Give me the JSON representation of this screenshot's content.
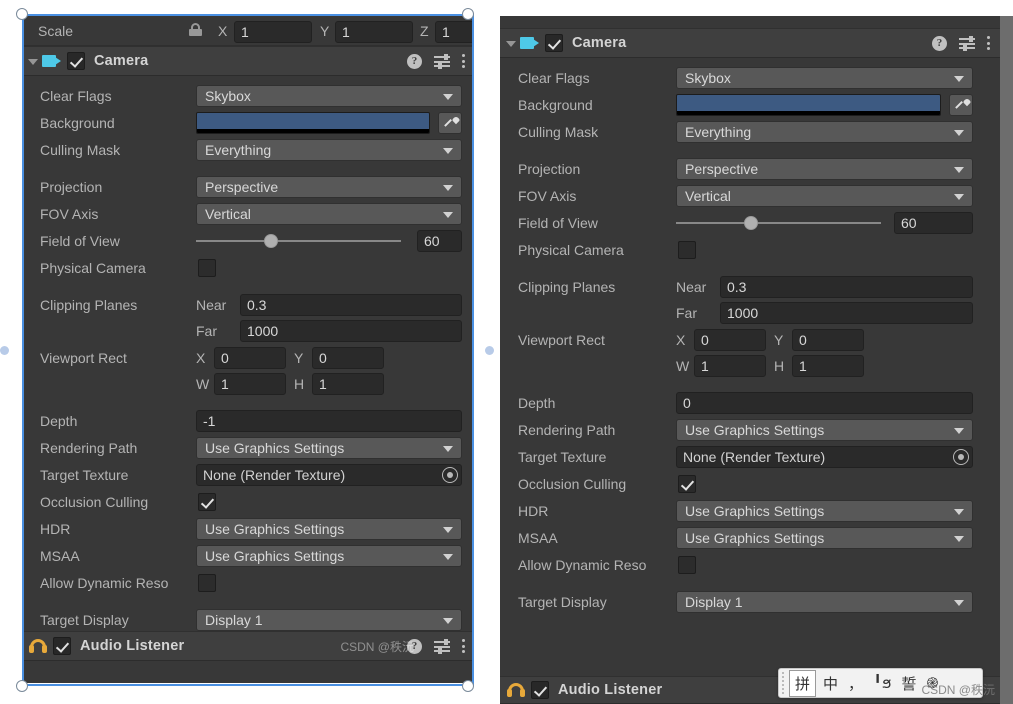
{
  "app": {
    "name": "Unity Inspector — Camera component comparison"
  },
  "scale_strip": {
    "label": "Scale",
    "lock_icon": "link-lock-icon",
    "axes": [
      {
        "axis": "X",
        "value": "1"
      },
      {
        "axis": "Y",
        "value": "1"
      },
      {
        "axis": "Z",
        "value": "1"
      }
    ]
  },
  "header_icons": {
    "help": "?",
    "help_name": "help-icon",
    "preset_name": "preset-settings-icon",
    "menu_name": "more-options-icon"
  },
  "left_panel": {
    "component": {
      "title": "Camera",
      "enabled": true,
      "icon": "camera-icon"
    },
    "fields": {
      "clear_flags_label": "Clear Flags",
      "clear_flags_value": "Skybox",
      "background_label": "Background",
      "background_color": "#3d5a82",
      "culling_mask_label": "Culling Mask",
      "culling_mask_value": "Everything",
      "projection_label": "Projection",
      "projection_value": "Perspective",
      "fov_axis_label": "FOV Axis",
      "fov_axis_value": "Vertical",
      "field_of_view_label": "Field of View",
      "field_of_view_value": "60",
      "field_of_view_percent": 33,
      "physical_camera_label": "Physical Camera",
      "physical_camera_checked": false,
      "clipping_planes_label": "Clipping Planes",
      "near_label": "Near",
      "near_value": "0.3",
      "far_label": "Far",
      "far_value": "1000",
      "viewport_rect_label": "Viewport Rect",
      "viewport_x_label": "X",
      "viewport_x_value": "0",
      "viewport_y_label": "Y",
      "viewport_y_value": "0",
      "viewport_w_label": "W",
      "viewport_w_value": "1",
      "viewport_h_label": "H",
      "viewport_h_value": "1",
      "depth_label": "Depth",
      "depth_value": "-1",
      "rendering_path_label": "Rendering Path",
      "rendering_path_value": "Use Graphics Settings",
      "target_texture_label": "Target Texture",
      "target_texture_value": "None (Render Texture)",
      "occlusion_culling_label": "Occlusion Culling",
      "occlusion_culling_checked": true,
      "hdr_label": "HDR",
      "hdr_value": "Use Graphics Settings",
      "msaa_label": "MSAA",
      "msaa_value": "Use Graphics Settings",
      "allow_dynamic_label": "Allow Dynamic Reso",
      "allow_dynamic_checked": false,
      "target_display_label": "Target Display",
      "target_display_value": "Display 1"
    },
    "audio_listener": {
      "title": "Audio Listener",
      "enabled": true,
      "icon": "headphones-icon"
    },
    "watermark": "CSDN @秩沅"
  },
  "right_panel": {
    "component": {
      "title": "Camera",
      "enabled": true,
      "icon": "camera-icon"
    },
    "fields": {
      "clear_flags_label": "Clear Flags",
      "clear_flags_value": "Skybox",
      "background_label": "Background",
      "background_color": "#3d5a82",
      "culling_mask_label": "Culling Mask",
      "culling_mask_value": "Everything",
      "projection_label": "Projection",
      "projection_value": "Perspective",
      "fov_axis_label": "FOV Axis",
      "fov_axis_value": "Vertical",
      "field_of_view_label": "Field of View",
      "field_of_view_value": "60",
      "field_of_view_percent": 33,
      "physical_camera_label": "Physical Camera",
      "physical_camera_checked": false,
      "clipping_planes_label": "Clipping Planes",
      "near_label": "Near",
      "near_value": "0.3",
      "far_label": "Far",
      "far_value": "1000",
      "viewport_rect_label": "Viewport Rect",
      "viewport_x_label": "X",
      "viewport_x_value": "0",
      "viewport_y_label": "Y",
      "viewport_y_value": "0",
      "viewport_w_label": "W",
      "viewport_w_value": "1",
      "viewport_h_label": "H",
      "viewport_h_value": "1",
      "depth_label": "Depth",
      "depth_value": "0",
      "rendering_path_label": "Rendering Path",
      "rendering_path_value": "Use Graphics Settings",
      "target_texture_label": "Target Texture",
      "target_texture_value": "None (Render Texture)",
      "occlusion_culling_label": "Occlusion Culling",
      "occlusion_culling_checked": true,
      "hdr_label": "HDR",
      "hdr_value": "Use Graphics Settings",
      "msaa_label": "MSAA",
      "msaa_value": "Use Graphics Settings",
      "allow_dynamic_label": "Allow Dynamic Reso",
      "allow_dynamic_checked": false,
      "target_display_label": "Target Display",
      "target_display_value": "Display 1"
    },
    "audio_listener": {
      "title": "Audio Listener",
      "enabled": true,
      "icon": "headphones-icon"
    },
    "watermark": "CSDN @秩沅"
  },
  "ime_bar": {
    "items": [
      "拼",
      "中",
      "，",
      "╹ϧ",
      "誓",
      "֎"
    ]
  }
}
